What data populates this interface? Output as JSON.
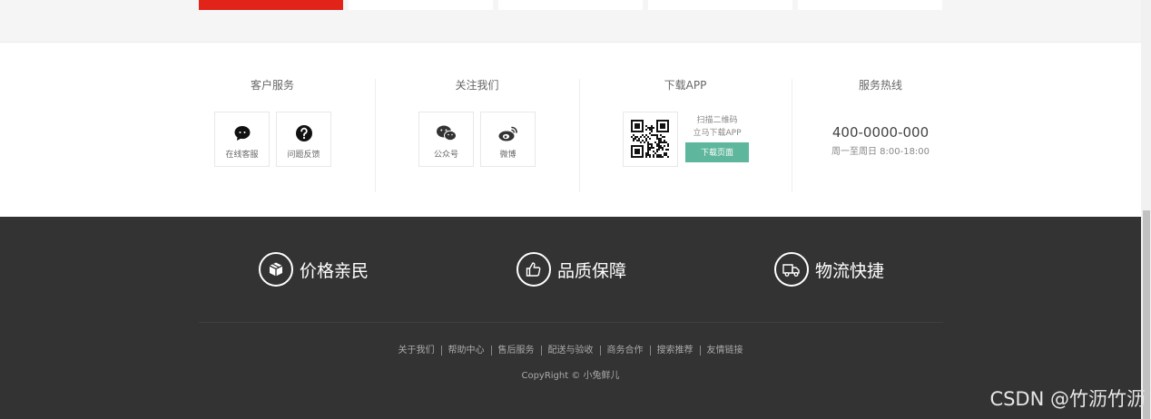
{
  "service": {
    "columns": [
      {
        "title": "客户服务",
        "items": [
          {
            "label": "在线客服",
            "icon": "chat-bubble-icon"
          },
          {
            "label": "问题反馈",
            "icon": "question-icon"
          }
        ]
      },
      {
        "title": "关注我们",
        "items": [
          {
            "label": "公众号",
            "icon": "wechat-icon"
          },
          {
            "label": "微博",
            "icon": "weibo-icon"
          }
        ]
      },
      {
        "title": "下载APP",
        "qr_line1": "扫描二维码",
        "qr_line2": "立马下载APP",
        "download_button": "下载页面"
      },
      {
        "title": "服务热线",
        "phone": "400-0000-000",
        "hours": "周一至周日 8:00-18:00"
      }
    ]
  },
  "features": [
    {
      "label": "价格亲民",
      "icon": "box-icon"
    },
    {
      "label": "品质保障",
      "icon": "thumbs-up-icon"
    },
    {
      "label": "物流快捷",
      "icon": "truck-icon"
    }
  ],
  "footer_links": [
    "关于我们",
    "帮助中心",
    "售后服务",
    "配送与验收",
    "商务合作",
    "搜索推荐",
    "友情链接"
  ],
  "copyright": "CopyRight © 小兔鲜儿",
  "watermark": "CSDN @竹沥竹沥",
  "colors": {
    "accent_green": "#5eb69c",
    "footer_bg": "#333333",
    "brand_red": "#e2231a"
  }
}
